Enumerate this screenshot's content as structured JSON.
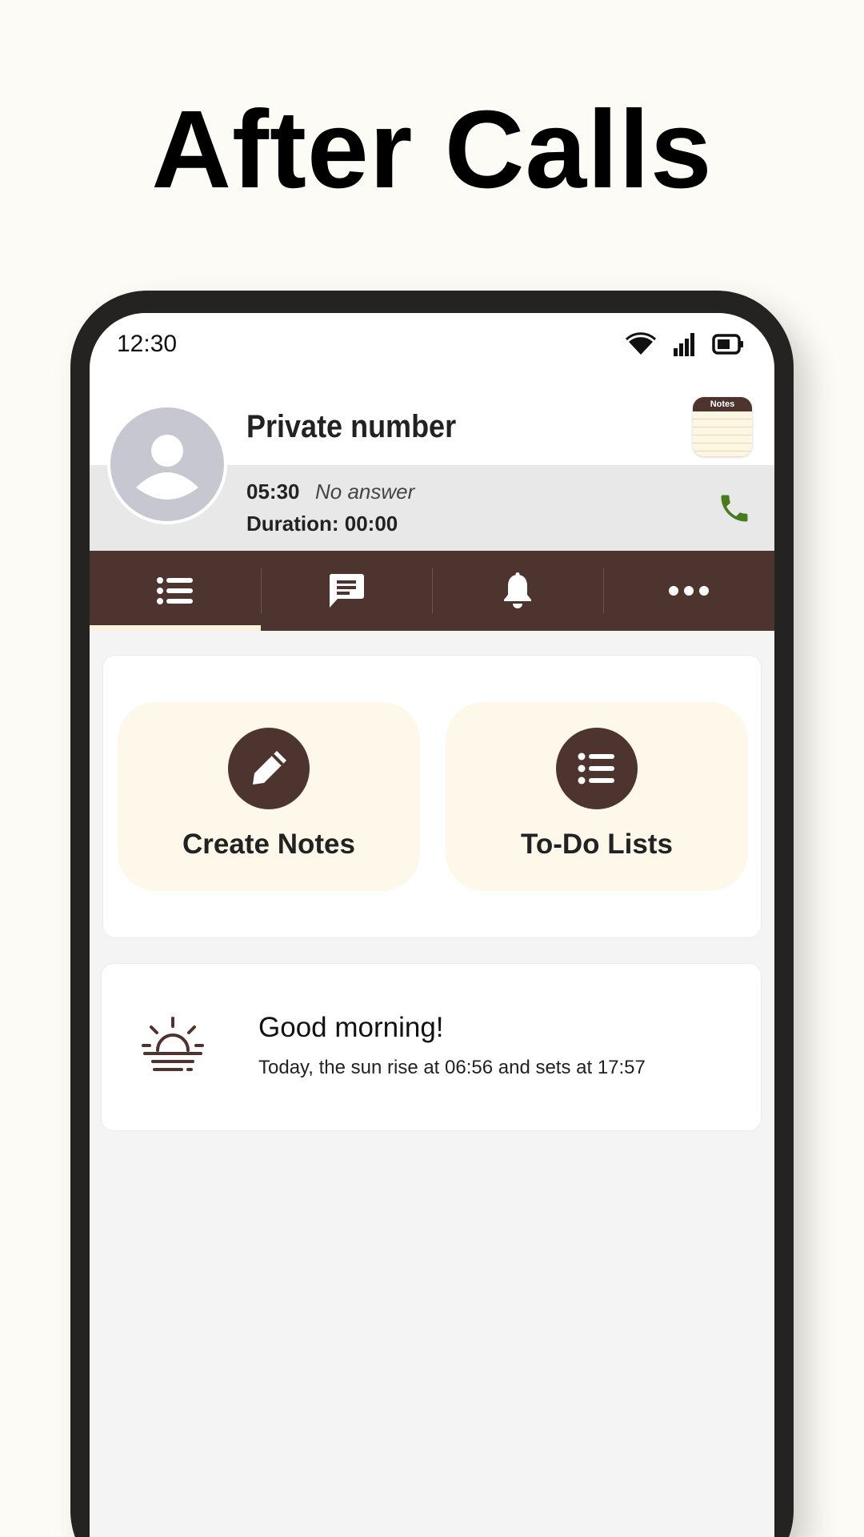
{
  "headline": "After Calls",
  "status_bar": {
    "time": "12:30"
  },
  "caller": {
    "name": "Private number",
    "call_time": "05:30",
    "call_status": "No answer",
    "duration": "Duration: 00:00",
    "app_badge": "Notes"
  },
  "tabs": [
    {
      "icon": "list-icon",
      "active": true
    },
    {
      "icon": "message-icon",
      "active": false
    },
    {
      "icon": "bell-icon",
      "active": false
    },
    {
      "icon": "more-icon",
      "active": false
    }
  ],
  "actions": {
    "create_notes": "Create Notes",
    "todo_lists": "To-Do Lists"
  },
  "greeting": {
    "title": "Good morning!",
    "text": "Today, the sun rise at 06:56 and sets at 17:57"
  },
  "colors": {
    "brand_brown": "#4e342e",
    "cream": "#fef8ea",
    "call_green": "#4a7a1e",
    "avatar_grey": "#c6c7d1"
  }
}
